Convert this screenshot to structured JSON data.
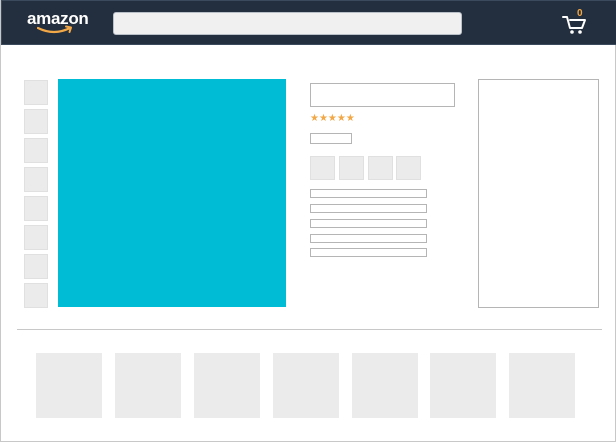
{
  "header": {
    "logo_text": "amazon",
    "logo_icon": "amazon-smile-icon",
    "search": {
      "value": "",
      "placeholder": ""
    },
    "cart": {
      "count": "0",
      "icon": "shopping-cart-icon"
    }
  },
  "product": {
    "thumbnail_count": 8,
    "main_image_color": "#00bcd4",
    "rating": {
      "stars": "★★★★★",
      "value": 5,
      "max": 5
    },
    "option_count": 4,
    "bullet_count": 5
  },
  "related": {
    "count": 7
  },
  "colors": {
    "header_bg": "#232f3e",
    "accent": "#f3a847",
    "placeholder": "#ebebeb",
    "image": "#00bcd4"
  }
}
